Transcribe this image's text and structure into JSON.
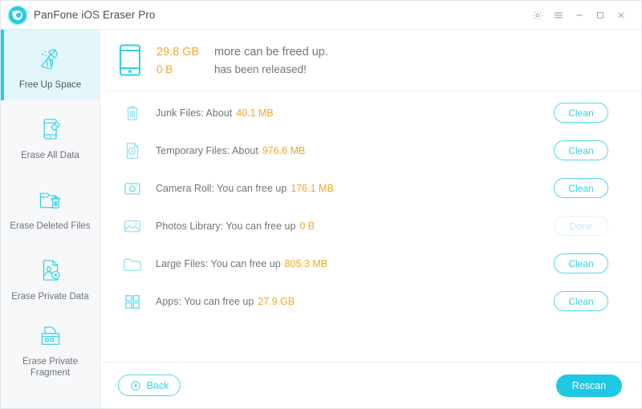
{
  "window": {
    "title": "PanFone iOS Eraser Pro",
    "logo_icon": "panfone-logo-icon",
    "controls": [
      {
        "name": "settings-gear-icon",
        "label": "Settings"
      },
      {
        "name": "menu-icon",
        "label": "Menu"
      },
      {
        "name": "minimize-icon",
        "label": "Minimize"
      },
      {
        "name": "maximize-icon",
        "label": "Maximize"
      },
      {
        "name": "close-icon",
        "label": "Close"
      }
    ]
  },
  "colors": {
    "accent": "#25cde5",
    "accent_soft": "#e3f7fa",
    "amount": "#f5a623",
    "text": "#6f757c",
    "disabled": "#bfe9ef"
  },
  "sidebar": {
    "items": [
      {
        "label": "Free Up Space",
        "icon": "broom-icon",
        "active": true
      },
      {
        "label": "Erase All Data",
        "icon": "phone-eraser-icon",
        "active": false
      },
      {
        "label": "Erase Deleted Files",
        "icon": "folder-trash-icon",
        "active": false
      },
      {
        "label": "Erase Private Data",
        "icon": "private-contact-icon",
        "active": false
      },
      {
        "label": "Erase Private Fragment",
        "icon": "fragment-blocks-icon",
        "active": false
      }
    ]
  },
  "summary": {
    "device_icon": "phone-icon",
    "freed_amount": "29.8 GB",
    "freed_text": "more can be freed up.",
    "released_amount": "0 B",
    "released_text": "has been released!"
  },
  "list": {
    "rows": [
      {
        "icon": "trash-icon",
        "label": "Junk Files: About",
        "amount": "40.1 MB",
        "button": "Clean",
        "disabled": false
      },
      {
        "icon": "clock-doc-icon",
        "label": "Temporary Files: About",
        "amount": "976.6 MB",
        "button": "Clean",
        "disabled": false
      },
      {
        "icon": "camera-icon",
        "label": "Camera Roll: You can free up",
        "amount": "176.1 MB",
        "button": "Clean",
        "disabled": false
      },
      {
        "icon": "photo-icon",
        "label": "Photos Library: You can free up",
        "amount": "0 B",
        "button": "Done",
        "disabled": true
      },
      {
        "icon": "folder-icon",
        "label": "Large Files: You can free up",
        "amount": "805.3 MB",
        "button": "Clean",
        "disabled": false
      },
      {
        "icon": "apps-grid-icon",
        "label": "Apps: You can free up",
        "amount": "27.9 GB",
        "button": "Clean",
        "disabled": false
      }
    ]
  },
  "footer": {
    "back_label": "Back",
    "back_icon": "arrow-left-circle-icon",
    "rescan_label": "Rescan"
  }
}
